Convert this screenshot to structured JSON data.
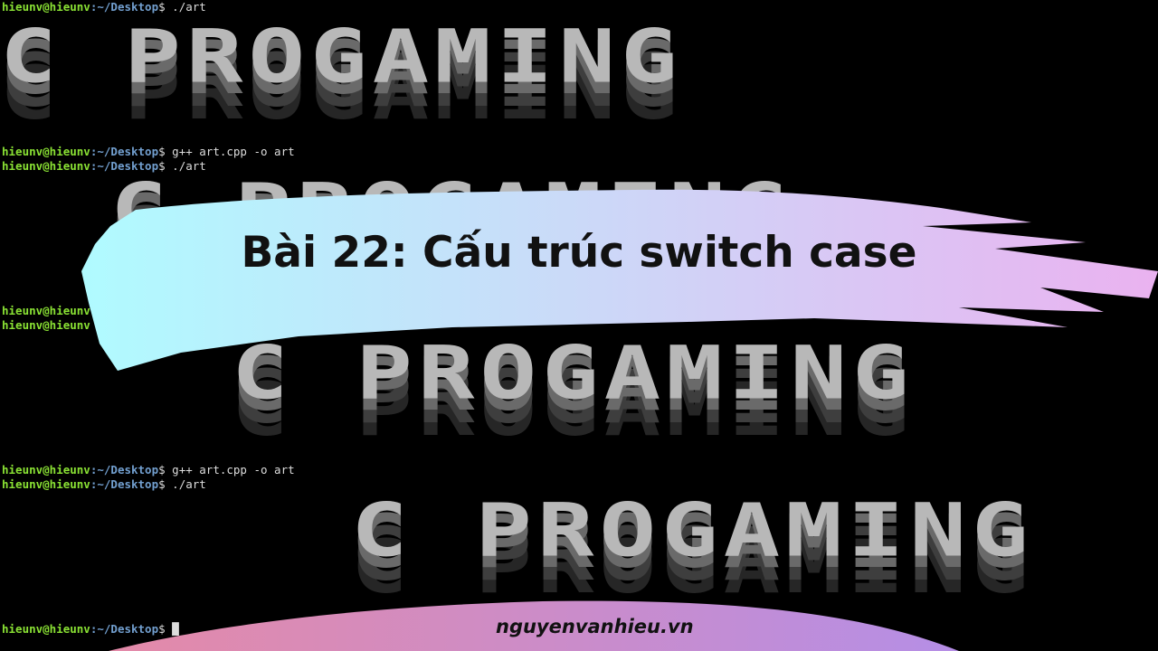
{
  "terminal": {
    "user": "hieunv@hieunv",
    "path": ":~/Desktop",
    "prompt": "$",
    "lines": [
      {
        "cmd": " ./art"
      },
      {
        "cmd": " g++ art.cpp -o art"
      },
      {
        "cmd": " ./art"
      },
      {
        "cmd": ""
      },
      {
        "cmd": ""
      },
      {
        "cmd": " g++ art.cpp -o art"
      },
      {
        "cmd": " ./art"
      },
      {
        "cmd": " █"
      }
    ],
    "art_text": "C PROGAMING"
  },
  "banner": {
    "title": "Bài 22: Cấu trúc switch case"
  },
  "footer": {
    "site": "nguyenvanhieu.vn"
  },
  "colors": {
    "banner_start": "#b0fbff",
    "banner_end": "#eab2f0",
    "footer_start": "#e48aa8",
    "footer_end": "#b58ee6"
  }
}
